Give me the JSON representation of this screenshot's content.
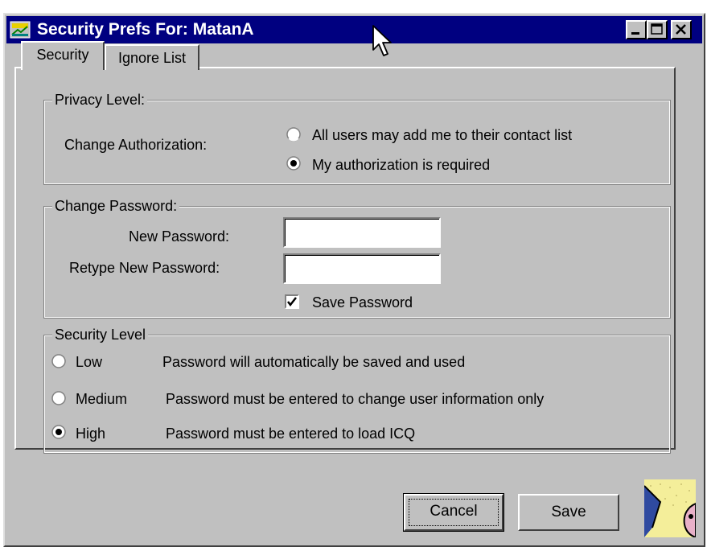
{
  "window": {
    "title": "Security Prefs For: MatanA",
    "icon": "icq-app-icon",
    "controls": [
      "minimize-icon",
      "maximize-icon",
      "close-icon"
    ]
  },
  "tabs": [
    {
      "label": "Security",
      "selected": true
    },
    {
      "label": "Ignore List",
      "selected": false
    }
  ],
  "privacy": {
    "legend": "Privacy Level:",
    "change_label": "Change Authorization:",
    "options": [
      {
        "label": "All users may add me to their contact list",
        "selected": false
      },
      {
        "label": "My authorization is required",
        "selected": true
      }
    ]
  },
  "password": {
    "legend": "Change Password:",
    "new_label": "New Password:",
    "new_value": "",
    "retype_label": "Retype New Password:",
    "retype_value": "",
    "save_label": "Save Password",
    "save_checked": true
  },
  "security_level": {
    "legend": "Security Level",
    "levels": [
      {
        "label": "Low",
        "desc": "Password will automatically be saved and used",
        "selected": false
      },
      {
        "label": "Medium",
        "desc": "Password must be entered to change user information only",
        "selected": false
      },
      {
        "label": "High",
        "desc": "Password must be entered to load ICQ",
        "selected": true
      }
    ]
  },
  "buttons": {
    "cancel": "Cancel",
    "save": "Save"
  },
  "colors": {
    "titlebar": "#000080",
    "face": "#c0c0c0",
    "avatar_bg": "#f4ee9a"
  }
}
